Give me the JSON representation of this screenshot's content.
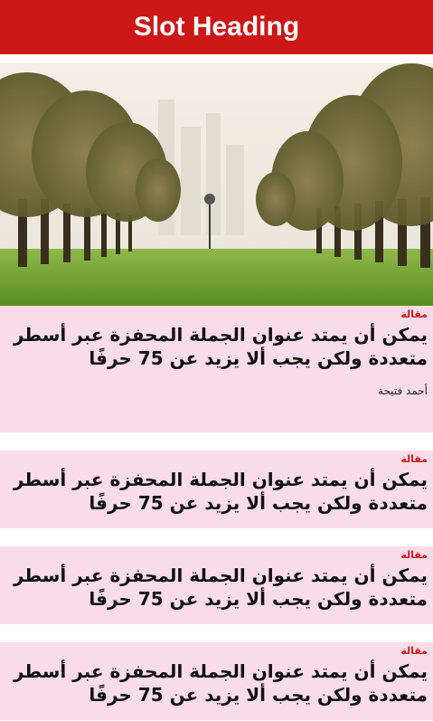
{
  "header": {
    "title": "Slot Heading"
  },
  "hero": {
    "image_name": "palm-tree-avenue-image"
  },
  "articles": [
    {
      "kicker": "مقالة",
      "title": "يمكن أن يمتد عنوان الجملة المحفزة عبر أسطر متعددة ولكن يجب ألا يزيد عن 75 حرفًا",
      "author": "أحمد فتيحة"
    },
    {
      "kicker": "مقالة",
      "title": "يمكن أن يمتد عنوان الجملة المحفزة عبر أسطر متعددة ولكن يجب ألا يزيد عن 75 حرفًا"
    },
    {
      "kicker": "مقالة",
      "title": "يمكن أن يمتد عنوان الجملة المحفزة عبر أسطر متعددة ولكن يجب ألا يزيد عن 75 حرفًا"
    },
    {
      "kicker": "مقالة",
      "title": "يمكن أن يمتد عنوان الجملة المحفزة عبر أسطر متعددة ولكن يجب ألا يزيد عن 75 حرفًا"
    }
  ],
  "colors": {
    "brand": "#cc1717",
    "card_bg": "#f9dce9"
  }
}
